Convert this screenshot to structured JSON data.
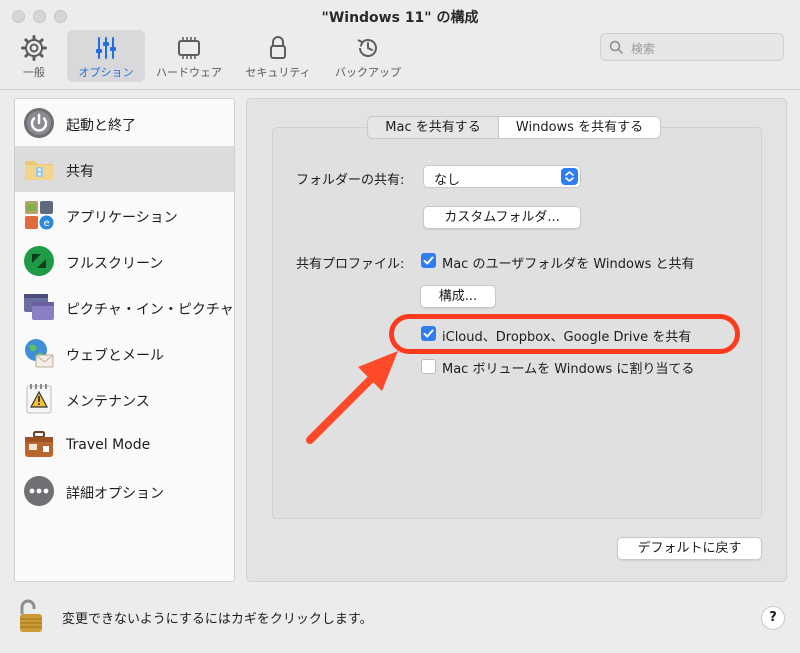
{
  "window": {
    "title": "\"Windows 11\" の構成"
  },
  "toolbar": {
    "items": [
      {
        "label": "一般"
      },
      {
        "label": "オプション"
      },
      {
        "label": "ハードウェア"
      },
      {
        "label": "セキュリティ"
      },
      {
        "label": "バックアップ"
      }
    ],
    "active_index": 1,
    "search_placeholder": "検索"
  },
  "sidebar": {
    "items": [
      {
        "label": "起動と終了",
        "icon": "power-icon"
      },
      {
        "label": "共有",
        "icon": "shared-folder-icon"
      },
      {
        "label": "アプリケーション",
        "icon": "applications-icon"
      },
      {
        "label": "フルスクリーン",
        "icon": "fullscreen-icon"
      },
      {
        "label": "ピクチャ・イン・ピクチャ",
        "icon": "picture-in-picture-icon"
      },
      {
        "label": "ウェブとメール",
        "icon": "web-mail-icon"
      },
      {
        "label": "メンテナンス",
        "icon": "maintenance-icon"
      },
      {
        "label": "Travel Mode",
        "icon": "suitcase-icon"
      },
      {
        "label": "詳細オプション",
        "icon": "more-options-icon"
      }
    ],
    "selected_index": 1
  },
  "sharing": {
    "tabs": [
      {
        "label": "Mac を共有する"
      },
      {
        "label": "Windows を共有する"
      }
    ],
    "active_tab_index": 1,
    "folder_share_label": "フォルダーの共有:",
    "folder_share_value": "なし",
    "custom_folder_button": "カスタムフォルダ...",
    "profile_label": "共有プロファイル:",
    "share_user_folders": {
      "label": "Mac のユーザフォルダを Windows と共有",
      "checked": true
    },
    "configure_button": "構成...",
    "share_cloud": {
      "label": "iCloud、Dropbox、Google Drive を共有",
      "checked": true
    },
    "map_volumes": {
      "label": "Mac ボリュームを Windows に割り当てる",
      "checked": false
    },
    "restore_defaults_button": "デフォルトに戻す"
  },
  "footer": {
    "lock_text": "変更できないようにするにはカギをクリックします。",
    "help_label": "?"
  },
  "colors": {
    "accent": "#2f7ef1",
    "highlight": "#ff3b1f"
  }
}
